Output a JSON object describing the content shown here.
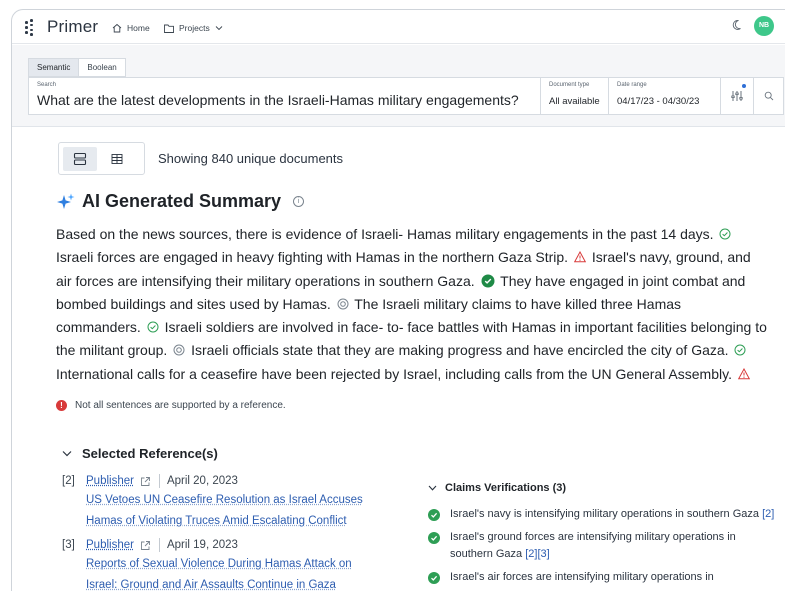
{
  "app": {
    "name": "Primer",
    "avatar_initials": "NB"
  },
  "nav": {
    "home": "Home",
    "projects": "Projects"
  },
  "search": {
    "tabs": [
      "Semantic",
      "Boolean"
    ],
    "label": "Search",
    "query": "What are the latest developments in the Israeli-Hamas military engagements?",
    "document_type_label": "Document type",
    "document_type_value": "All available",
    "date_range_label": "Date range",
    "date_range_value": "04/17/23 - 04/30/23"
  },
  "results": {
    "showing": "Showing 840 unique documents"
  },
  "summary": {
    "title": "AI Generated Summary",
    "s1": "Based on the news sources, there is evidence of Israeli- Hamas military engagements in the past 14 days.",
    "s2": "Israeli forces are engaged in heavy fighting with Hamas in the northern Gaza Strip.",
    "s3": "Israel's navy, ground, and air forces are intensifying their military operations in southern Gaza.",
    "s4": "They have engaged in joint combat and bombed buildings and sites used by Hamas.",
    "s5": "The Israeli military claims to have killed three Hamas commanders.",
    "s6": "Israeli soldiers are involved in face- to- face battles with Hamas in important facilities belonging to the militant group.",
    "s7": "Israeli officials state that they are making progress and have encircled the city of Gaza.",
    "s8": "International calls for a ceasefire have been rejected by Israel, including calls from the UN General Assembly.",
    "warning": "Not all sentences are supported by a reference."
  },
  "references": {
    "heading": "Selected Reference(s)",
    "items": [
      {
        "num": "[2]",
        "publisher": "Publisher",
        "date": "April 20, 2023",
        "title_line1": "US Vetoes UN Ceasefire Resolution as Israel Accuses",
        "title_line2": "Hamas of Violating Truces Amid Escalating Conflict"
      },
      {
        "num": "[3]",
        "publisher": "Publisher",
        "date": "April 19, 2023",
        "title_line1": "Reports of Sexual Violence During Hamas Attack on",
        "title_line2": "Israel: Ground and Air Assaults Continue in Gaza"
      }
    ]
  },
  "claims": {
    "heading": "Claims Verifications (3)",
    "items": [
      {
        "text": "Israel's navy is intensifying military operations in southern Gaza",
        "refs": "[2]"
      },
      {
        "text": "Israel's ground forces are intensifying military operations in southern Gaza",
        "refs": "[2][3]"
      },
      {
        "text": "Israel's air forces are intensifying military operations in",
        "refs": ""
      }
    ]
  },
  "colors": {
    "accent": "#3ec78a",
    "link": "#2d5db0",
    "verified": "#2e9e55",
    "warning": "#d83a3a",
    "sparkle": "#2f7fe0"
  }
}
